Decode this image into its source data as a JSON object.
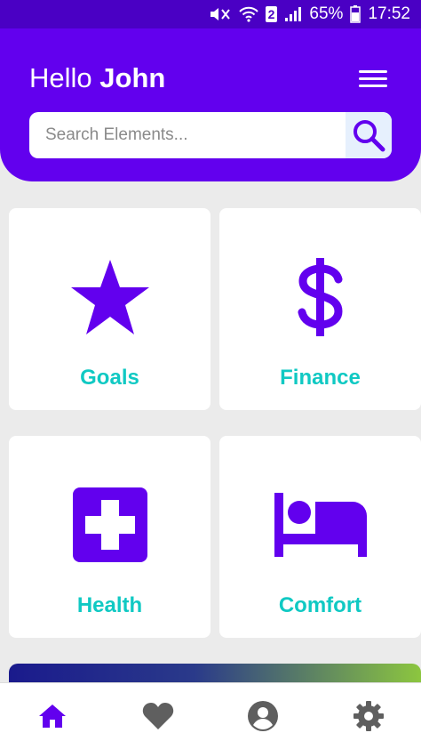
{
  "status_bar": {
    "battery": "65%",
    "time": "17:52",
    "sim_badge": "2",
    "icons": [
      "mute-icon",
      "wifi-icon",
      "signal-icon",
      "battery-icon"
    ]
  },
  "header": {
    "greeting": "Hello",
    "user_name": "John",
    "menu_icon": "hamburger-menu-icon"
  },
  "search": {
    "placeholder": "Search Elements...",
    "value": "",
    "icon": "search-icon"
  },
  "cards": [
    {
      "label": "Goals",
      "icon": "star-icon"
    },
    {
      "label": "Finance",
      "icon": "dollar-icon"
    },
    {
      "label": "Health",
      "icon": "medical-cross-icon"
    },
    {
      "label": "Comfort",
      "icon": "bed-icon"
    }
  ],
  "bottom_nav": [
    {
      "icon": "home-icon",
      "active": true
    },
    {
      "icon": "heart-icon",
      "active": false
    },
    {
      "icon": "profile-icon",
      "active": false
    },
    {
      "icon": "settings-icon",
      "active": false
    }
  ],
  "colors": {
    "primary": "#6200ee",
    "status_bar": "#4a00c4",
    "card_label": "#10c9c3",
    "icon": "#6200ee",
    "nav_active": "#6200ee",
    "nav_inactive": "#5f5f5f",
    "banner_gradient": [
      "#1a1a8c",
      "#8cc63f"
    ]
  }
}
